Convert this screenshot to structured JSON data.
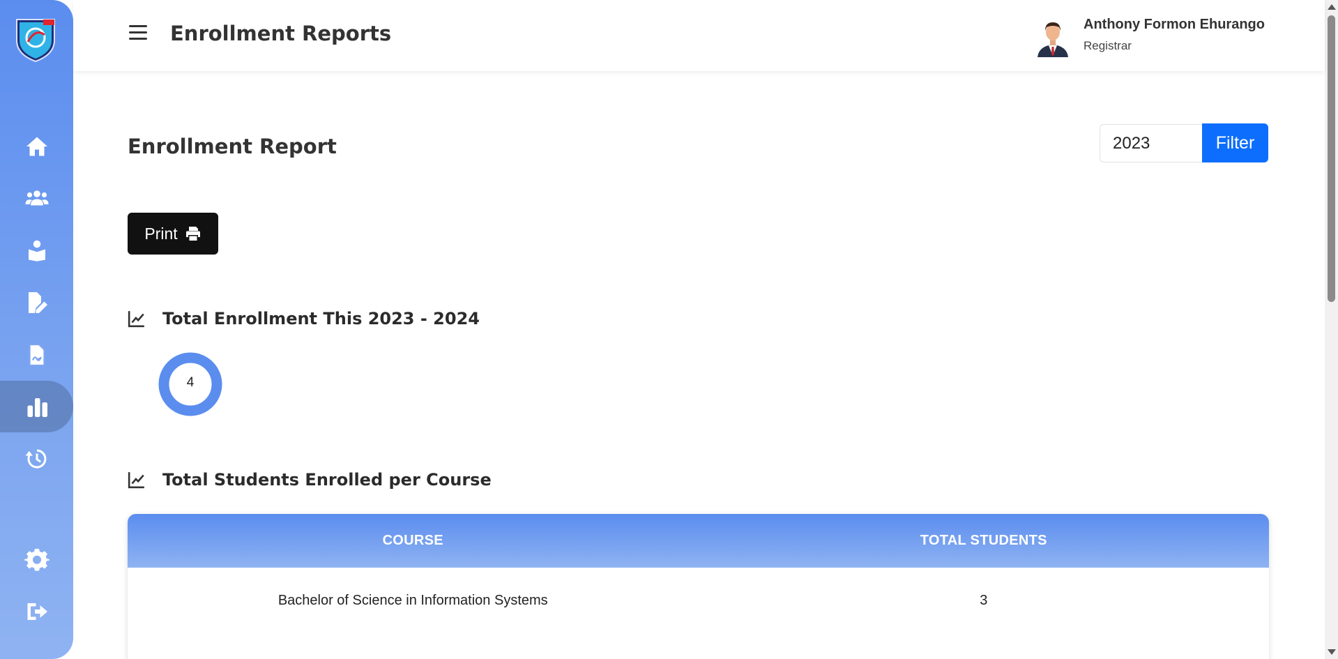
{
  "header": {
    "title": "Enrollment Reports",
    "user": {
      "name": "Anthony Formon Ehurango",
      "role": "Registrar"
    }
  },
  "sidebar": {
    "items": [
      {
        "icon": "home-icon"
      },
      {
        "icon": "users-icon"
      },
      {
        "icon": "student-reading-icon"
      },
      {
        "icon": "file-edit-icon"
      },
      {
        "icon": "file-signature-icon"
      },
      {
        "icon": "bar-chart-icon",
        "active": true
      },
      {
        "icon": "history-icon"
      },
      {
        "icon": "gear-icon"
      },
      {
        "icon": "logout-icon"
      }
    ],
    "accent_color": "#5b8def"
  },
  "report": {
    "title": "Enrollment Report",
    "year_value": "2023",
    "filter_label": "Filter",
    "print_label": "Print",
    "total_section": "Total Enrollment This 2023 - 2024",
    "total_value": "4",
    "per_course_section": "Total Students Enrolled per Course"
  },
  "table": {
    "headers": [
      "COURSE",
      "TOTAL STUDENTS"
    ],
    "rows": [
      [
        "Bachelor of Science in Information Systems",
        "3"
      ]
    ]
  },
  "colors": {
    "primary_button": "#0d6efd",
    "print_button": "#111111",
    "donut": "#5b8def"
  }
}
